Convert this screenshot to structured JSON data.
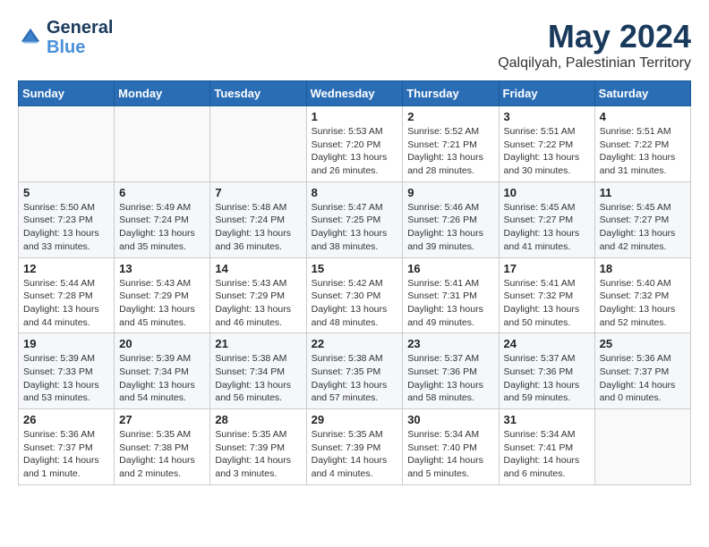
{
  "header": {
    "logo_line1": "General",
    "logo_line2": "Blue",
    "month": "May 2024",
    "location": "Qalqilyah, Palestinian Territory"
  },
  "days_of_week": [
    "Sunday",
    "Monday",
    "Tuesday",
    "Wednesday",
    "Thursday",
    "Friday",
    "Saturday"
  ],
  "weeks": [
    [
      {
        "day": "",
        "info": ""
      },
      {
        "day": "",
        "info": ""
      },
      {
        "day": "",
        "info": ""
      },
      {
        "day": "1",
        "info": "Sunrise: 5:53 AM\nSunset: 7:20 PM\nDaylight: 13 hours and 26 minutes."
      },
      {
        "day": "2",
        "info": "Sunrise: 5:52 AM\nSunset: 7:21 PM\nDaylight: 13 hours and 28 minutes."
      },
      {
        "day": "3",
        "info": "Sunrise: 5:51 AM\nSunset: 7:22 PM\nDaylight: 13 hours and 30 minutes."
      },
      {
        "day": "4",
        "info": "Sunrise: 5:51 AM\nSunset: 7:22 PM\nDaylight: 13 hours and 31 minutes."
      }
    ],
    [
      {
        "day": "5",
        "info": "Sunrise: 5:50 AM\nSunset: 7:23 PM\nDaylight: 13 hours and 33 minutes."
      },
      {
        "day": "6",
        "info": "Sunrise: 5:49 AM\nSunset: 7:24 PM\nDaylight: 13 hours and 35 minutes."
      },
      {
        "day": "7",
        "info": "Sunrise: 5:48 AM\nSunset: 7:24 PM\nDaylight: 13 hours and 36 minutes."
      },
      {
        "day": "8",
        "info": "Sunrise: 5:47 AM\nSunset: 7:25 PM\nDaylight: 13 hours and 38 minutes."
      },
      {
        "day": "9",
        "info": "Sunrise: 5:46 AM\nSunset: 7:26 PM\nDaylight: 13 hours and 39 minutes."
      },
      {
        "day": "10",
        "info": "Sunrise: 5:45 AM\nSunset: 7:27 PM\nDaylight: 13 hours and 41 minutes."
      },
      {
        "day": "11",
        "info": "Sunrise: 5:45 AM\nSunset: 7:27 PM\nDaylight: 13 hours and 42 minutes."
      }
    ],
    [
      {
        "day": "12",
        "info": "Sunrise: 5:44 AM\nSunset: 7:28 PM\nDaylight: 13 hours and 44 minutes."
      },
      {
        "day": "13",
        "info": "Sunrise: 5:43 AM\nSunset: 7:29 PM\nDaylight: 13 hours and 45 minutes."
      },
      {
        "day": "14",
        "info": "Sunrise: 5:43 AM\nSunset: 7:29 PM\nDaylight: 13 hours and 46 minutes."
      },
      {
        "day": "15",
        "info": "Sunrise: 5:42 AM\nSunset: 7:30 PM\nDaylight: 13 hours and 48 minutes."
      },
      {
        "day": "16",
        "info": "Sunrise: 5:41 AM\nSunset: 7:31 PM\nDaylight: 13 hours and 49 minutes."
      },
      {
        "day": "17",
        "info": "Sunrise: 5:41 AM\nSunset: 7:32 PM\nDaylight: 13 hours and 50 minutes."
      },
      {
        "day": "18",
        "info": "Sunrise: 5:40 AM\nSunset: 7:32 PM\nDaylight: 13 hours and 52 minutes."
      }
    ],
    [
      {
        "day": "19",
        "info": "Sunrise: 5:39 AM\nSunset: 7:33 PM\nDaylight: 13 hours and 53 minutes."
      },
      {
        "day": "20",
        "info": "Sunrise: 5:39 AM\nSunset: 7:34 PM\nDaylight: 13 hours and 54 minutes."
      },
      {
        "day": "21",
        "info": "Sunrise: 5:38 AM\nSunset: 7:34 PM\nDaylight: 13 hours and 56 minutes."
      },
      {
        "day": "22",
        "info": "Sunrise: 5:38 AM\nSunset: 7:35 PM\nDaylight: 13 hours and 57 minutes."
      },
      {
        "day": "23",
        "info": "Sunrise: 5:37 AM\nSunset: 7:36 PM\nDaylight: 13 hours and 58 minutes."
      },
      {
        "day": "24",
        "info": "Sunrise: 5:37 AM\nSunset: 7:36 PM\nDaylight: 13 hours and 59 minutes."
      },
      {
        "day": "25",
        "info": "Sunrise: 5:36 AM\nSunset: 7:37 PM\nDaylight: 14 hours and 0 minutes."
      }
    ],
    [
      {
        "day": "26",
        "info": "Sunrise: 5:36 AM\nSunset: 7:37 PM\nDaylight: 14 hours and 1 minute."
      },
      {
        "day": "27",
        "info": "Sunrise: 5:35 AM\nSunset: 7:38 PM\nDaylight: 14 hours and 2 minutes."
      },
      {
        "day": "28",
        "info": "Sunrise: 5:35 AM\nSunset: 7:39 PM\nDaylight: 14 hours and 3 minutes."
      },
      {
        "day": "29",
        "info": "Sunrise: 5:35 AM\nSunset: 7:39 PM\nDaylight: 14 hours and 4 minutes."
      },
      {
        "day": "30",
        "info": "Sunrise: 5:34 AM\nSunset: 7:40 PM\nDaylight: 14 hours and 5 minutes."
      },
      {
        "day": "31",
        "info": "Sunrise: 5:34 AM\nSunset: 7:41 PM\nDaylight: 14 hours and 6 minutes."
      },
      {
        "day": "",
        "info": ""
      }
    ]
  ]
}
